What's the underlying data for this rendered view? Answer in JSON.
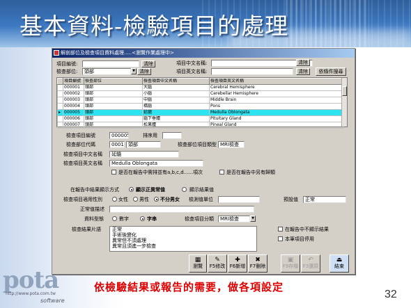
{
  "slide": {
    "title": "基本資料-檢驗項目的處理",
    "caption": "依檢驗結果或報告的需要，做各項設定",
    "page_number": "32",
    "logo": "pota",
    "logo_url": "http://www.pota.com.tw",
    "logo_sub": "software"
  },
  "window": {
    "title": "解剖部位及檢查項目資料處理.....<瀏覽作業處理中>"
  },
  "search": {
    "code_label": "項目編號:",
    "clear1": "清除",
    "cname_label": "項目中文名稱:",
    "clear2": "清除",
    "part_label": "檢查部位:",
    "part_value": "頭部",
    "clear3": "清除",
    "ename_label": "項目英文名稱:",
    "clear4": "清除",
    "search_button": "依條件搜尋"
  },
  "grid": {
    "columns": [
      "項目編號",
      "檢查部位",
      "檢查項目中文名稱",
      "檢查項目英文名稱"
    ],
    "rows": [
      [
        "000001",
        "頭部",
        "大腦",
        "Cerebral Hemisphere"
      ],
      [
        "000002",
        "頭部",
        "小腦",
        "Cerebellar Hemisphere"
      ],
      [
        "000003",
        "頭部",
        "中腦",
        "Middle Brain"
      ],
      [
        "000004",
        "頭部",
        "橋腦",
        "Pons"
      ],
      [
        "000005",
        "頭部",
        "延髓",
        "Medulla Oblongata"
      ],
      [
        "000006",
        "頭部",
        "腦下垂體",
        "Pituitary Gland"
      ],
      [
        "000007",
        "頭部",
        "松果體",
        "Pineal Gland"
      ]
    ],
    "selected_index": 4
  },
  "detail": {
    "code_label": "檢查項目編號",
    "code_value": "000005",
    "order_label": "排序用",
    "order_value": "",
    "part_code_label": "檢查部位代碼",
    "part_code_value": "0001",
    "part_name_value": "頭部",
    "part_type_label": "檢查部位項目類型",
    "part_type_value": "MRI檢查",
    "cname_label": "檢查項目中文名稱",
    "cname_value": "延髓",
    "ename_label": "檢查項目英文名稱",
    "ename_value": "Medulla Oblongata",
    "check_report_other": "是否在報告中需排並有a,b,c,d......項次",
    "check_report_extra": "是否在報告中另有歸類",
    "display_mode_label": "在報告中結果顯示方式",
    "display_opt1": "顯示正異常值",
    "display_opt2": "顯示結果值",
    "gender_label": "檢查項目適用性別",
    "gender_opt1": "女性",
    "gender_opt2": "男性",
    "gender_opt3": "不分男女",
    "unit_label": "檢測值單位",
    "unit_value": "",
    "default_label": "預設值",
    "default_value": "正常",
    "normal_label": "正常值描述",
    "normal_value": "",
    "format_label": "資料型態",
    "format_opt1": "數字",
    "format_opt2": "字串",
    "category_label": "檢查項目分類",
    "category_value": "MRI檢查",
    "phrases_label": "檢查結果片語",
    "phrases": [
      "正常",
      "手術後變化",
      "異常但不須處理",
      "異常且須進一步檢查"
    ],
    "check_hide": "在報告中不顯示結果",
    "check_disable": "本筆項目停用"
  },
  "toolbar": {
    "browse": "瀏覽",
    "f5": "F5修改",
    "f6": "F6新增",
    "f7": "F7刪除",
    "f9": "F9存檔",
    "f3": "F3還原",
    "exit": "結束"
  }
}
